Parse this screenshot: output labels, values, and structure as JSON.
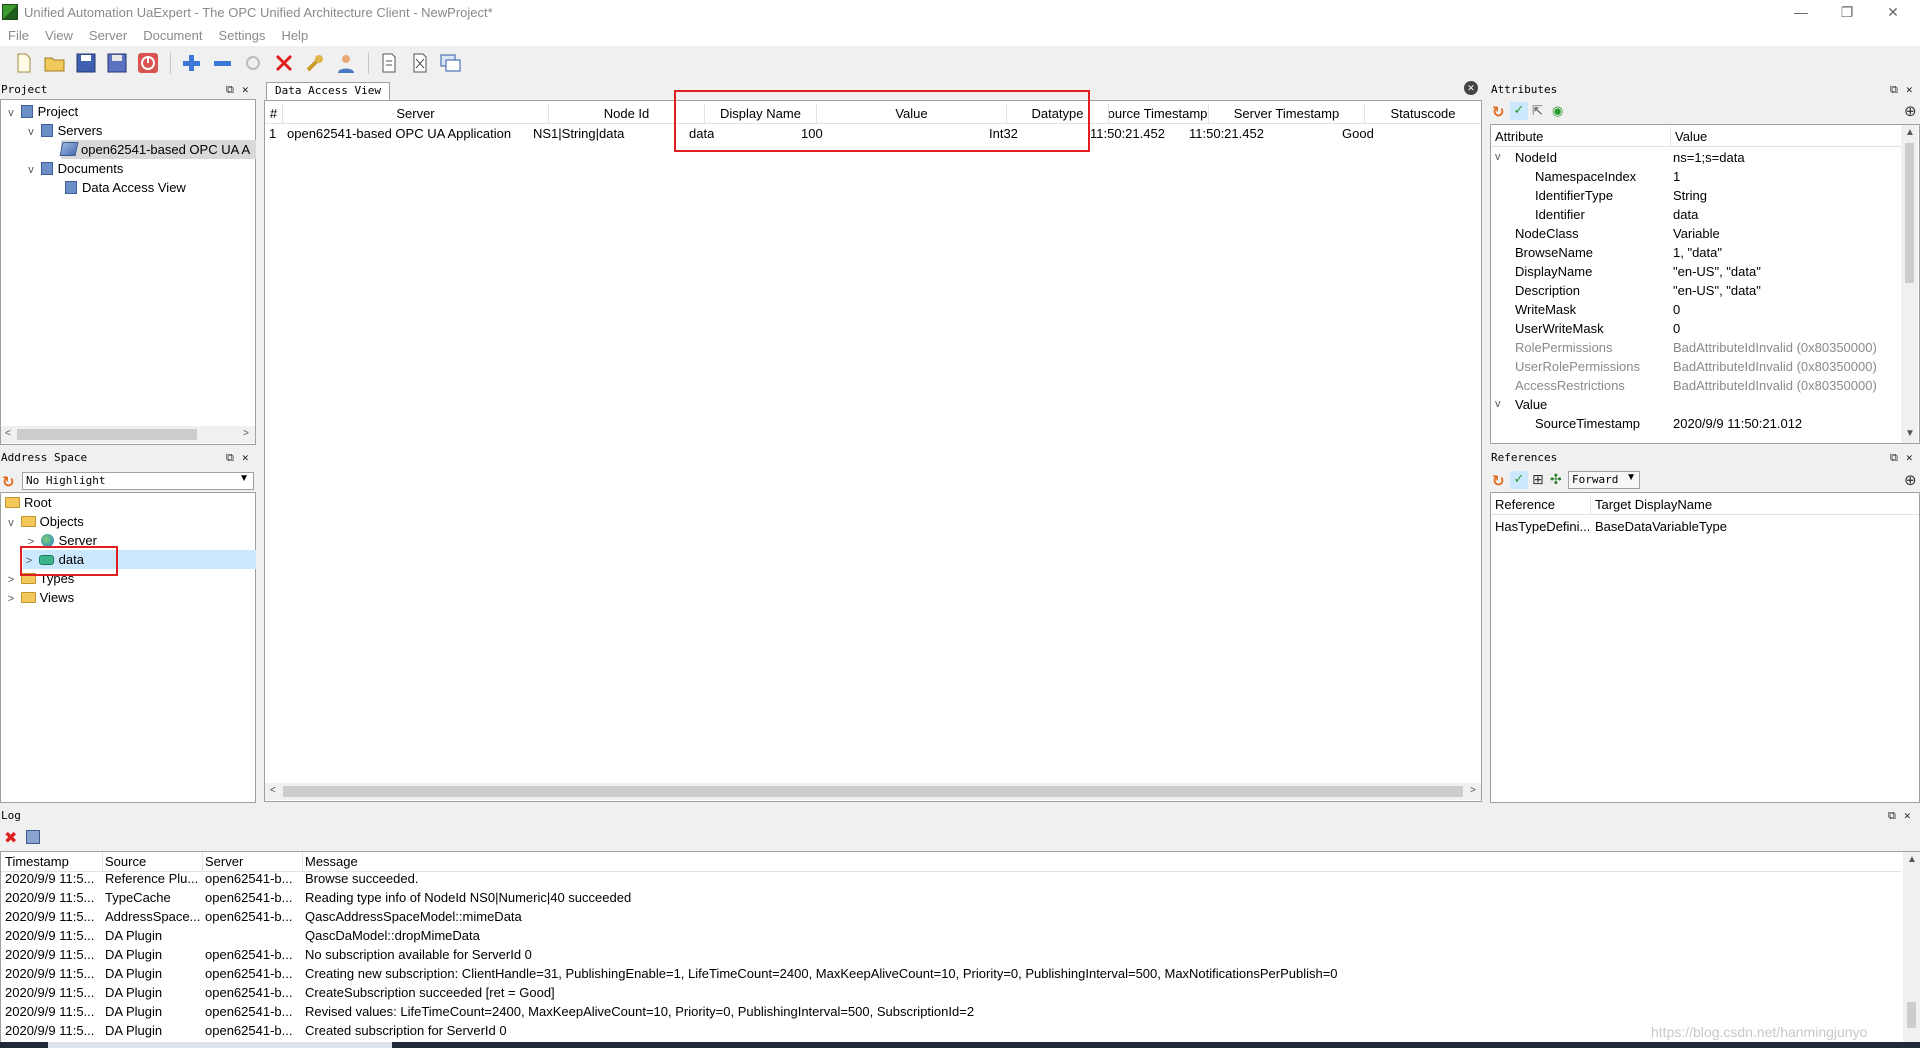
{
  "window": {
    "title": "Unified Automation UaExpert - The OPC Unified Architecture Client - NewProject*",
    "minimize": "—",
    "restore": "❐",
    "close": "✕"
  },
  "menu": [
    "File",
    "View",
    "Server",
    "Document",
    "Settings",
    "Help"
  ],
  "toolbar": {
    "icons": [
      "new-document-icon",
      "open-folder-icon",
      "save-icon",
      "save-as-icon",
      "power-icon",
      "add-server-icon",
      "remove-server-icon",
      "connect-icon",
      "disconnect-icon",
      "settings-wrench-icon",
      "user-icon",
      "add-document-icon",
      "remove-document-icon",
      "windows-icon"
    ]
  },
  "project": {
    "header": "Project",
    "tree": [
      {
        "label": "Project",
        "level": 0,
        "icon": "project-icon",
        "expanded": true
      },
      {
        "label": "Servers",
        "level": 1,
        "icon": "project-icon",
        "expanded": true
      },
      {
        "label": "open62541-based OPC UA A",
        "level": 2,
        "icon": "server-icon",
        "selected": true
      },
      {
        "label": "Documents",
        "level": 1,
        "icon": "project-icon",
        "expanded": true
      },
      {
        "label": "Data Access View",
        "level": 2,
        "icon": "project-icon"
      }
    ]
  },
  "address_space": {
    "header": "Address Space",
    "highlight_select": "No Highlight",
    "tree": [
      {
        "label": "Root",
        "level": 0,
        "icon": "folder-icon"
      },
      {
        "label": "Objects",
        "level": 0,
        "icon": "folder-icon",
        "expanded": true
      },
      {
        "label": "Server",
        "level": 1,
        "icon": "globe-icon"
      },
      {
        "label": "data",
        "level": 1,
        "icon": "variable-icon",
        "selected": true
      },
      {
        "label": "Types",
        "level": 0,
        "icon": "folder-icon"
      },
      {
        "label": "Views",
        "level": 0,
        "icon": "folder-icon"
      }
    ]
  },
  "data_access": {
    "tab": "Data Access View",
    "columns": [
      "#",
      "Server",
      "Node Id",
      "Display Name",
      "Value",
      "Datatype",
      "Source Timestamp",
      "Server Timestamp",
      "Statuscode"
    ],
    "rows": [
      [
        "1",
        "open62541-based OPC UA Application",
        "NS1|String|data",
        "data",
        "100",
        "Int32",
        "11:50:21.452",
        "11:50:21.452",
        "Good"
      ]
    ]
  },
  "attributes": {
    "header": "Attributes",
    "col_attribute": "Attribute",
    "col_value": "Value",
    "rows": [
      {
        "name": "NodeId",
        "value": "ns=1;s=data",
        "level": 0,
        "exp": "v"
      },
      {
        "name": "NamespaceIndex",
        "value": "1",
        "level": 1
      },
      {
        "name": "IdentifierType",
        "value": "String",
        "level": 1
      },
      {
        "name": "Identifier",
        "value": "data",
        "level": 1
      },
      {
        "name": "NodeClass",
        "value": "Variable",
        "level": 0
      },
      {
        "name": "BrowseName",
        "value": "1, \"data\"",
        "level": 0
      },
      {
        "name": "DisplayName",
        "value": "\"en-US\", \"data\"",
        "level": 0
      },
      {
        "name": "Description",
        "value": "\"en-US\", \"data\"",
        "level": 0
      },
      {
        "name": "WriteMask",
        "value": "0",
        "level": 0
      },
      {
        "name": "UserWriteMask",
        "value": "0",
        "level": 0
      },
      {
        "name": "RolePermissions",
        "value": "BadAttributeIdInvalid (0x80350000)",
        "level": 0,
        "grey": true
      },
      {
        "name": "UserRolePermissions",
        "value": "BadAttributeIdInvalid (0x80350000)",
        "level": 0,
        "grey": true
      },
      {
        "name": "AccessRestrictions",
        "value": "BadAttributeIdInvalid (0x80350000)",
        "level": 0,
        "grey": true
      },
      {
        "name": "Value",
        "value": "",
        "level": 0,
        "exp": "v"
      },
      {
        "name": "SourceTimestamp",
        "value": "2020/9/9 11:50:21.012",
        "level": 1
      }
    ]
  },
  "references": {
    "header": "References",
    "direction": "Forward",
    "col_reference": "Reference",
    "col_target": "Target DisplayName",
    "rows": [
      {
        "reference": "HasTypeDefini...",
        "target": "BaseDataVariableType"
      }
    ]
  },
  "log": {
    "header": "Log",
    "columns": [
      "Timestamp",
      "Source",
      "Server",
      "Message"
    ],
    "rows": [
      [
        "2020/9/9 11:5...",
        "Reference Plu...",
        "open62541-b...",
        "Browse succeeded."
      ],
      [
        "2020/9/9 11:5...",
        "TypeCache",
        "open62541-b...",
        "Reading type info of NodeId NS0|Numeric|40 succeeded"
      ],
      [
        "2020/9/9 11:5...",
        "AddressSpace...",
        "open62541-b...",
        "QascAddressSpaceModel::mimeData"
      ],
      [
        "2020/9/9 11:5...",
        "DA Plugin",
        "",
        "QascDaModel::dropMimeData"
      ],
      [
        "2020/9/9 11:5...",
        "DA Plugin",
        "open62541-b...",
        "No subscription available for ServerId 0"
      ],
      [
        "2020/9/9 11:5...",
        "DA Plugin",
        "open62541-b...",
        "Creating new subscription: ClientHandle=31, PublishingEnable=1, LifeTimeCount=2400, MaxKeepAliveCount=10, Priority=0, PublishingInterval=500, MaxNotificationsPerPublish=0"
      ],
      [
        "2020/9/9 11:5...",
        "DA Plugin",
        "open62541-b...",
        "CreateSubscription succeeded [ret = Good]"
      ],
      [
        "2020/9/9 11:5...",
        "DA Plugin",
        "open62541-b...",
        "Revised values: LifeTimeCount=2400, MaxKeepAliveCount=10, Priority=0, PublishingInterval=500, SubscriptionId=2"
      ],
      [
        "2020/9/9 11:5...",
        "DA Plugin",
        "open62541-b...",
        "Created subscription for ServerId 0"
      ]
    ]
  },
  "watermark": "https://blog.csdn.net/hanmingjunyo",
  "accent": "#e02020"
}
